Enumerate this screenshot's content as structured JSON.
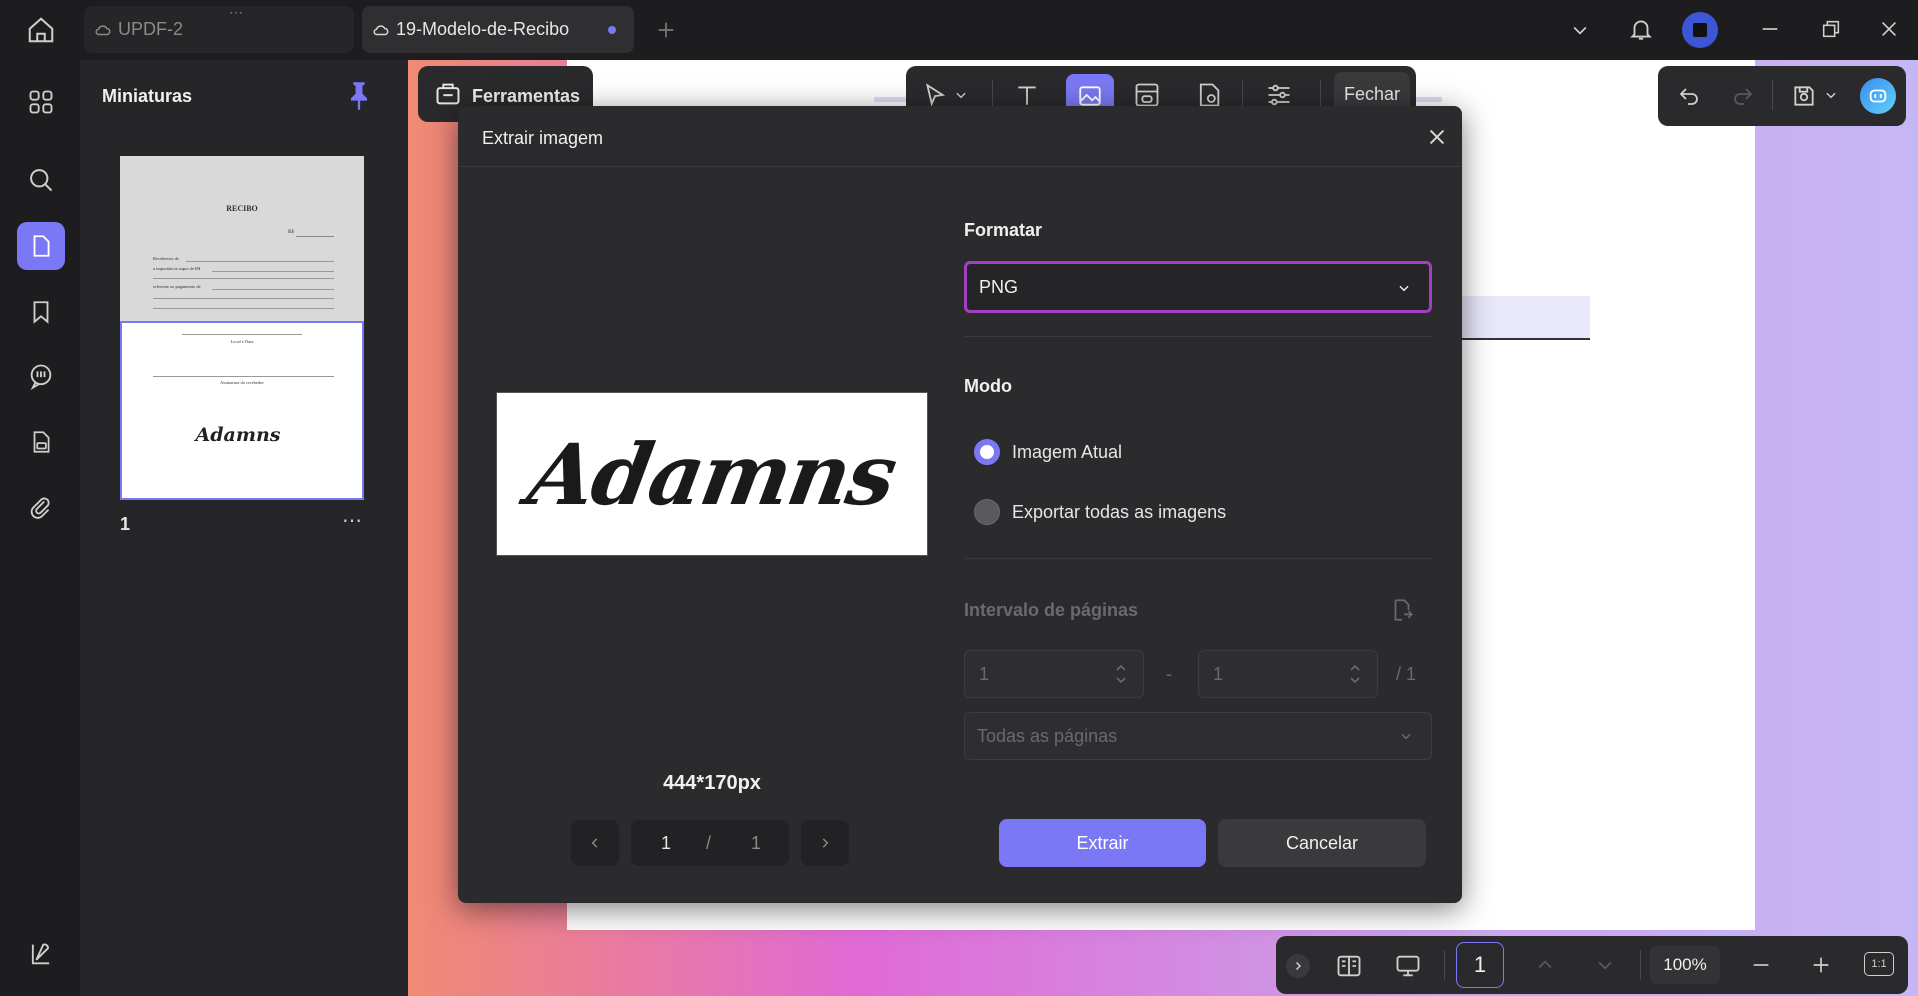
{
  "tabs": [
    {
      "label": "UPDF-2",
      "active": false
    },
    {
      "label": "19-Modelo-de-Recibo",
      "active": true
    }
  ],
  "thumbnails": {
    "title": "Miniaturas",
    "page_number": "1",
    "page_content": {
      "heading": "RECIBO",
      "amount_prefix": "R$",
      "line1": "Recebemos de",
      "line2": "a importância supra de R$",
      "line3": "referente ao pagamento de",
      "local_date": "Local e Data",
      "signature_caption": "Assinatura do recebedor",
      "signature": "Adamns"
    }
  },
  "toolbar": {
    "tools_label": "Ferramentas",
    "close_label": "Fechar"
  },
  "dialog": {
    "title": "Extrair imagem",
    "preview_signature": "Adamns",
    "preview_size": "444*170px",
    "pager": {
      "current": "1",
      "separator": "/",
      "total": "1"
    },
    "format": {
      "label": "Formatar",
      "value": "PNG"
    },
    "mode": {
      "label": "Modo",
      "option_current": "Imagem Atual",
      "option_all": "Exportar todas as imagens"
    },
    "range": {
      "label": "Intervalo de páginas",
      "from": "1",
      "dash": "-",
      "to": "1",
      "total": "/ 1",
      "select_value": "Todas as páginas"
    },
    "extract_label": "Extrair",
    "cancel_label": "Cancelar"
  },
  "bottombar": {
    "page_input": "1",
    "zoom": "100%",
    "fit_label": "1:1"
  },
  "colors": {
    "accent": "#7b78f5",
    "format_border": "#a53ec0",
    "dialog_bg": "#2b2b2e"
  }
}
